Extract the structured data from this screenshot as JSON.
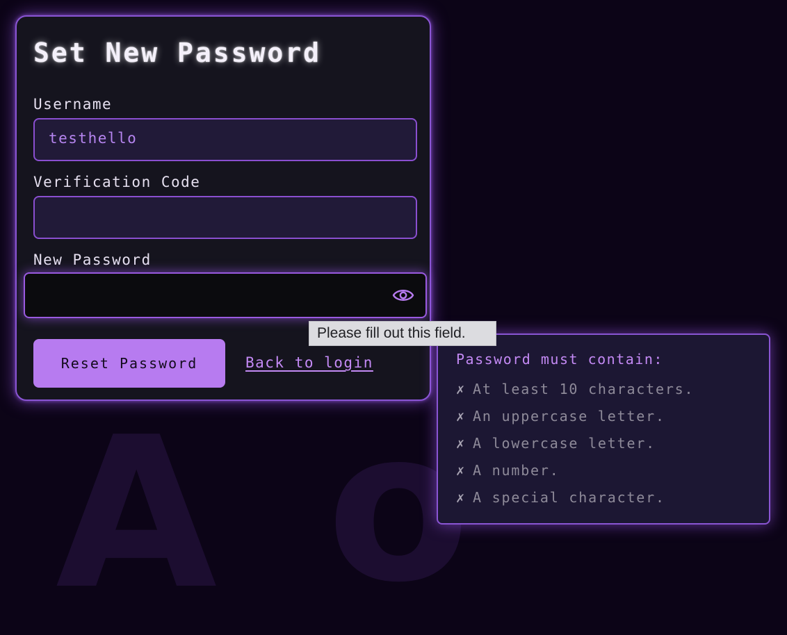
{
  "form": {
    "title": "Set New Password",
    "username_label": "Username",
    "username_value": "testhello",
    "code_label": "Verification Code",
    "code_value": "",
    "new_password_label": "New Password",
    "new_password_value": "",
    "show_password_icon": "eye-icon",
    "reset_button_label": "Reset Password",
    "back_link_label": "Back to login"
  },
  "validation_tooltip": {
    "text": "Please fill out this field."
  },
  "requirements": {
    "title": "Password must contain:",
    "fail_mark": "✗",
    "items": [
      "At least 10 characters.",
      "An uppercase letter.",
      "A lowercase letter.",
      "A number.",
      "A special character."
    ]
  },
  "colors": {
    "background": "#0c0417",
    "card": "#15141e",
    "accent": "#b77bf0",
    "border": "#8a55d4",
    "link": "#c48af5"
  }
}
